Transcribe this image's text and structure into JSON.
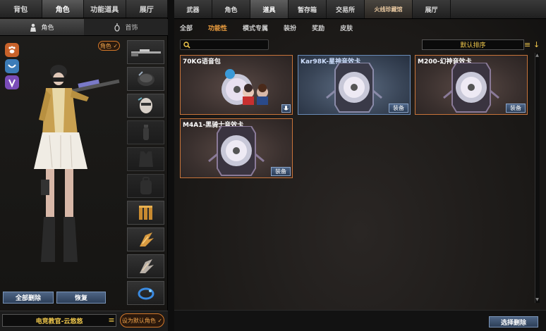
{
  "left": {
    "tabs": [
      "背包",
      "角色",
      "功能道具",
      "展厅"
    ],
    "active_tab": 1,
    "sub_tabs": [
      {
        "label": "角色",
        "icon": "character-icon"
      },
      {
        "label": "首饰",
        "icon": "accessory-icon"
      }
    ],
    "side_icons": [
      "paw-icon",
      "wave-icon",
      "leaf-icon"
    ],
    "role_badge": "角色 ✓",
    "slots": [
      {
        "name": "sniper-rifle-slot",
        "empty": false
      },
      {
        "name": "hat-slot",
        "empty": false
      },
      {
        "name": "mask-slot",
        "empty": false
      },
      {
        "name": "grenade-slot",
        "empty": true
      },
      {
        "name": "vest-slot",
        "empty": true
      },
      {
        "name": "backpack-slot",
        "empty": true
      },
      {
        "name": "ammo-slot",
        "empty": false
      },
      {
        "name": "wings-slot",
        "empty": false
      },
      {
        "name": "wings-slot-2",
        "empty": false
      },
      {
        "name": "charm-slot",
        "empty": false
      }
    ],
    "remove_all_label": "全部删除",
    "restore_label": "恢复",
    "preset_name": "电竞教官-云悠悠",
    "set_default_label": "设为默认角色 ✓"
  },
  "right": {
    "tabs": [
      "武器",
      "角色",
      "道具",
      "暂存箱",
      "交易所",
      "火线珍藏馆",
      "展厅"
    ],
    "active_tab": 2,
    "sub_tabs": [
      "全部",
      "功能性",
      "模式专属",
      "装扮",
      "奖励",
      "皮肤"
    ],
    "active_sub_tab": 1,
    "search_placeholder": "",
    "sort_label": "默认排序",
    "items": [
      {
        "title": "70KG语音包",
        "button": "",
        "style": "orange"
      },
      {
        "title": "Kar98K-星神音效卡",
        "button": "装备",
        "style": "blue"
      },
      {
        "title": "M200-幻神音效卡",
        "button": "装备",
        "style": "orange"
      },
      {
        "title": "M4A1-黑骑士音效卡",
        "button": "装备",
        "style": "orange"
      }
    ],
    "select_delete_label": "选择删除"
  },
  "colors": {
    "accent_orange": "#f0a040",
    "gold_text": "#f2c94c",
    "card_border_orange": "#c8743a",
    "card_border_blue": "#6a8cb8",
    "button_blue": "#4e6585"
  }
}
